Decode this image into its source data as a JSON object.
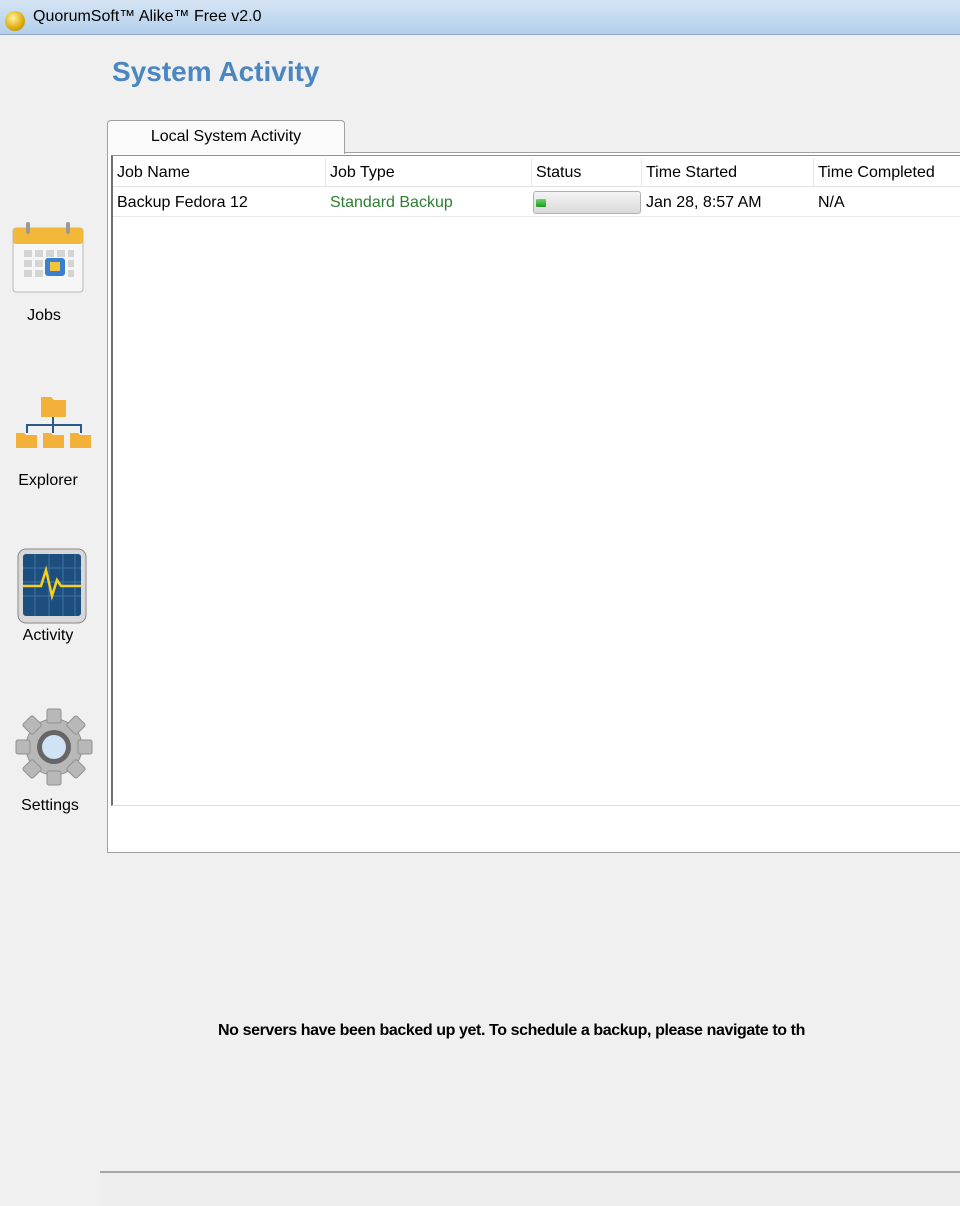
{
  "window": {
    "title": "QuorumSoft™ Alike™ Free v2.0"
  },
  "page": {
    "title": "System Activity"
  },
  "tabs": [
    {
      "label": "Local System Activity",
      "active": true
    }
  ],
  "sidebar": {
    "items": [
      {
        "label": "Jobs",
        "icon": "calendar-icon"
      },
      {
        "label": "Explorer",
        "icon": "folder-tree-icon"
      },
      {
        "label": "Activity",
        "icon": "activity-monitor-icon",
        "active": true
      },
      {
        "label": "Settings",
        "icon": "gear-icon"
      }
    ]
  },
  "table": {
    "columns": [
      "Job Name",
      "Job Type",
      "Status",
      "Time Started",
      "Time Completed"
    ],
    "rows": [
      {
        "job_name": "Backup Fedora 12",
        "job_type": "Standard Backup",
        "progress_percent": 10,
        "time_started": "Jan 28, 8:57 AM",
        "time_completed": "N/A"
      }
    ]
  },
  "message": "No servers have been backed up yet.  To schedule a backup, please navigate to th",
  "colors": {
    "accent": "#4a86c0",
    "job_type": "#2e7d32",
    "progress": "#1e9a1e"
  }
}
